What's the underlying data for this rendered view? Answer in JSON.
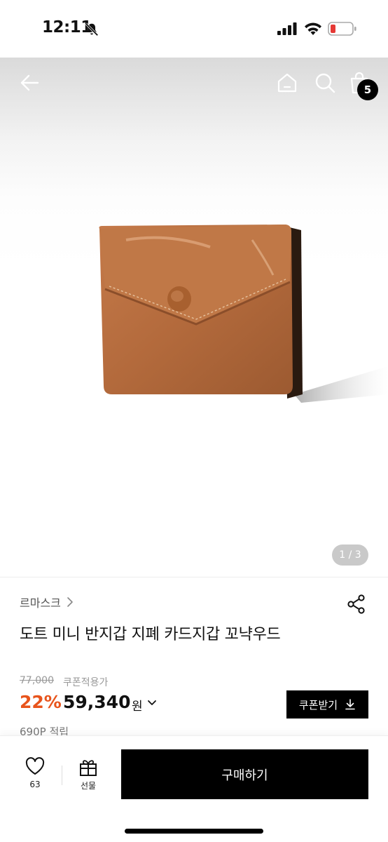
{
  "status_bar": {
    "time": "12:11",
    "icons": [
      "bell-slash-icon",
      "signal-icon",
      "wifi-icon",
      "battery-low-icon"
    ],
    "battery_color": "#e53935"
  },
  "toolbar": {
    "icons": [
      "back-arrow-icon",
      "home-icon",
      "search-icon",
      "cart-icon"
    ],
    "cart_count": "5"
  },
  "gallery": {
    "page_indicator": "1 / 3",
    "image": "brown leather mini wallet with snap button"
  },
  "product": {
    "brand": "르마스크",
    "title": "도트 미니 반지갑 지폐 카드지갑 꼬냑우드",
    "original_price": "77,000",
    "coupon_note": "쿠폰적용가",
    "discount_rate": "22%",
    "sale_price": "59,340",
    "currency": "원",
    "coupon_button": "쿠폰받기",
    "points": "690P 적립"
  },
  "bottom_bar": {
    "like_count": "63",
    "gift_label": "선물",
    "buy_label": "구매하기"
  },
  "colors": {
    "accent_discount": "#e8541c",
    "primary_button": "#000000"
  }
}
